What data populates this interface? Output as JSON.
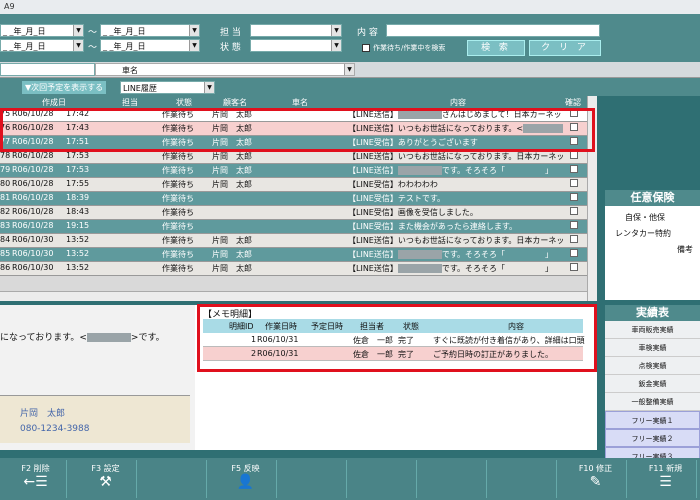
{
  "title_fragment": "A9",
  "search": {
    "date_from_1": "_ _年_月_日",
    "date_to_1": "_ _年_月_日",
    "date_from_2": "_ _年_月_日",
    "date_to_2": "_ _年_月_日",
    "tilde": "〜",
    "tanto_label": "担 当",
    "jotai_label": "状 態",
    "naiyo_label": "内 容",
    "checkbox_label": "作業待ち/作業中を検索",
    "search_button": "検 索",
    "clear_button": "ク リ ア"
  },
  "band": {
    "kurumamei_label": "車名"
  },
  "toolbar": {
    "toggle_label": "▼次回予定を表示する",
    "history_select": "LINE履歴"
  },
  "grid": {
    "headers": [
      "作成日",
      "担当",
      "状態",
      "顧客名",
      "車名",
      "内容",
      "確認"
    ],
    "rows": [
      {
        "id": "75",
        "date": "R06/10/28",
        "time": "17:42",
        "status": "作業待ち",
        "customer": "片岡　太郎",
        "content_pre": "【LINE送信】",
        "content_post": "さんはじめまして！日本カーネット株式",
        "style": "white"
      },
      {
        "id": "76",
        "date": "R06/10/28",
        "time": "17:43",
        "status": "作業待ち",
        "customer": "片岡　太郎",
        "content_pre": "【LINE送信】いつもお世話になっております。<",
        "content_post": ">",
        "style": "pink"
      },
      {
        "id": "77",
        "date": "R06/10/28",
        "time": "17:51",
        "status": "作業待ち",
        "customer": "片岡　太郎",
        "content_pre": "【LINE受信】ありがとうございます",
        "content_post": "",
        "style": "teal"
      },
      {
        "id": "78",
        "date": "R06/10/28",
        "time": "17:53",
        "status": "作業待ち",
        "customer": "片岡　太郎",
        "content_pre": "【LINE送信】いつもお世話になっております。日本カーネッ",
        "content_post": "",
        "style": "light"
      },
      {
        "id": "79",
        "date": "R06/10/28",
        "time": "17:53",
        "status": "作業待ち",
        "customer": "片岡　太郎",
        "content_pre": "【LINE送信】",
        "content_post": "です。そろそろ「　　　　　」",
        "style": "teal"
      },
      {
        "id": "80",
        "date": "R06/10/28",
        "time": "17:55",
        "status": "作業待ち",
        "customer": "片岡　太郎",
        "content_pre": "【LINE受信】わわわわわ",
        "content_post": "",
        "style": "light"
      },
      {
        "id": "81",
        "date": "R06/10/28",
        "time": "18:39",
        "status": "作業待ち",
        "customer": "",
        "content_pre": "【LINE受信】テストです。",
        "content_post": "",
        "style": "teal"
      },
      {
        "id": "82",
        "date": "R06/10/28",
        "time": "18:43",
        "status": "作業待ち",
        "customer": "",
        "content_pre": "【LINE受信】画像を受信しました。",
        "content_post": "",
        "style": "light"
      },
      {
        "id": "83",
        "date": "R06/10/28",
        "time": "19:15",
        "status": "作業待ち",
        "customer": "",
        "content_pre": "【LINE受信】また機会があったら連絡します。",
        "content_post": "",
        "style": "teal"
      },
      {
        "id": "84",
        "date": "R06/10/30",
        "time": "13:52",
        "status": "作業待ち",
        "customer": "片岡　太郎",
        "content_pre": "【LINE送信】いつもお世話になっております。日本カーネッ",
        "content_post": "",
        "style": "light"
      },
      {
        "id": "85",
        "date": "R06/10/30",
        "time": "13:52",
        "status": "作業待ち",
        "customer": "片岡　太郎",
        "content_pre": "【LINE送信】",
        "content_post": "です。そろそろ「　　　　　」",
        "style": "teal"
      },
      {
        "id": "86",
        "date": "R06/10/30",
        "time": "13:52",
        "status": "作業待ち",
        "customer": "片岡　太郎",
        "content_pre": "【LINE送信】",
        "content_post": "です。そろそろ「　　　　　」",
        "style": "light"
      }
    ]
  },
  "memo_preview": {
    "text_pre": "になっております。<",
    "text_post": ">です。"
  },
  "contact": {
    "name": "片岡　太郎",
    "phone": "080-1234-3988"
  },
  "memo": {
    "title": "【メモ明細】",
    "headers": [
      "明細ID",
      "作業日時",
      "予定日時",
      "担当者",
      "状態",
      "内容"
    ],
    "rows": [
      {
        "id": "1",
        "date": "R06/10/31",
        "planned": "",
        "staff": "佐倉　一郎",
        "status": "完了",
        "content": "すぐに既読が付き着信があり、詳細は口頭",
        "style": "white"
      },
      {
        "id": "2",
        "date": "R06/10/31",
        "planned": "",
        "staff": "佐倉　一郎",
        "status": "完了",
        "content": "ご予約日時の訂正がありました。",
        "style": "pink"
      }
    ]
  },
  "side": {
    "title": "任意保険",
    "items": [
      "自保・他保",
      "レンタカー特約",
      "備考"
    ],
    "results_title": "実績表",
    "results": [
      "車両販売実績",
      "車検実績",
      "点検実績",
      "鈑金実績",
      "一般整備実績",
      "フリー実績１",
      "フリー実績２",
      "フリー実績３"
    ]
  },
  "fkeys": [
    {
      "key": "F2 削除",
      "icon": "←☰"
    },
    {
      "key": "F3 設定",
      "icon": "⚒"
    },
    {
      "key": "",
      "icon": ""
    },
    {
      "key": "F5 反映",
      "icon": "👤"
    },
    {
      "key": "",
      "icon": ""
    },
    {
      "key": "",
      "icon": ""
    },
    {
      "key": "",
      "icon": ""
    },
    {
      "key": "",
      "icon": ""
    },
    {
      "key": "F10 修正",
      "icon": "✎"
    },
    {
      "key": "F11 新規",
      "icon": "☰"
    }
  ]
}
